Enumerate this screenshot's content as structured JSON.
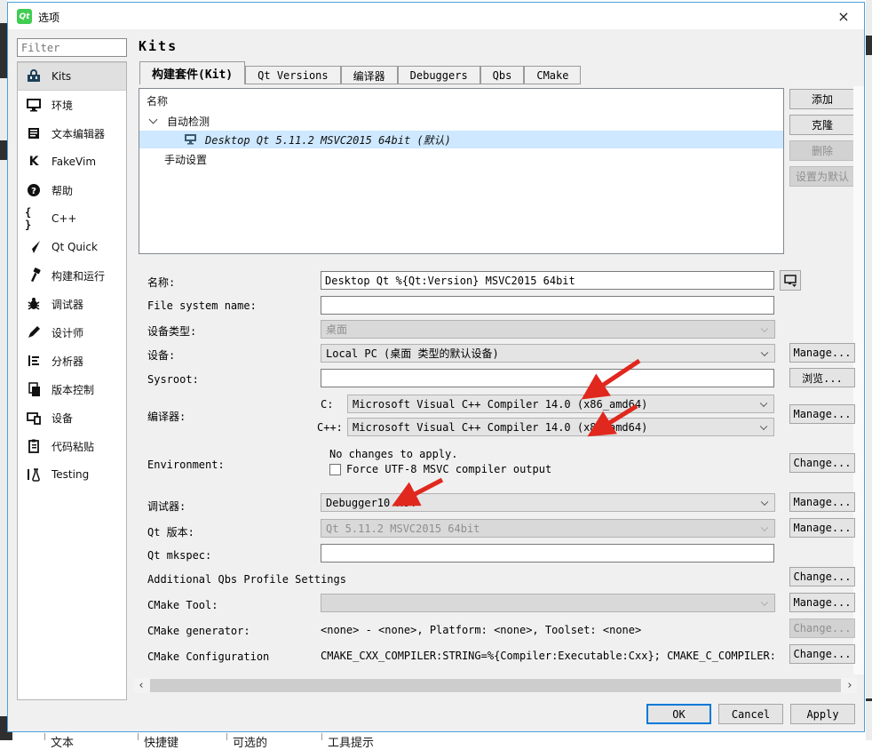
{
  "window": {
    "title": "选项",
    "close_glyph": "×"
  },
  "sidebar": {
    "filter_placeholder": "Filter",
    "items": [
      "Kits",
      "环境",
      "文本编辑器",
      "FakeVim",
      "帮助",
      "C++",
      "Qt Quick",
      "构建和运行",
      "调试器",
      "设计师",
      "分析器",
      "版本控制",
      "设备",
      "代码粘贴",
      "Testing"
    ]
  },
  "header": {
    "title": "Kits"
  },
  "tabs": [
    "构建套件(Kit)",
    "Qt Versions",
    "编译器",
    "Debuggers",
    "Qbs",
    "CMake"
  ],
  "tree": {
    "column_header": "名称",
    "auto_group": "自动检测",
    "kit_item": "Desktop Qt 5.11.2 MSVC2015 64bit (默认)",
    "manual_group": "手动设置"
  },
  "side_buttons": {
    "add": "添加",
    "clone": "克隆",
    "remove": "删除",
    "make_default": "设置为默认"
  },
  "form": {
    "name_label": "名称:",
    "name_value": "Desktop Qt %{Qt:Version} MSVC2015 64bit",
    "fs_label": "File system name:",
    "fs_value": "",
    "devtype_label": "设备类型:",
    "devtype_value": "桌面",
    "device_label": "设备:",
    "device_value": "Local PC (桌面 类型的默认设备)",
    "sysroot_label": "Sysroot:",
    "sysroot_value": "",
    "compiler_label": "编译器:",
    "c_label": "C:",
    "c_value": "Microsoft Visual C++ Compiler 14.0 (x86_amd64)",
    "cpp_label": "C++:",
    "cpp_value": "Microsoft Visual C++ Compiler 14.0 (x86_amd64)",
    "env_label": "Environment:",
    "env_status": "No changes to apply.",
    "env_checkbox_label": "Force UTF-8 MSVC compiler output",
    "debugger_label": "调试器:",
    "debugger_value": "Debugger10 x64",
    "qtver_label": "Qt 版本:",
    "qtver_value": "Qt 5.11.2 MSVC2015 64bit",
    "mkspec_label": "Qt mkspec:",
    "mkspec_value": "",
    "qbs_label": "Additional Qbs Profile Settings",
    "cmaketool_label": "CMake Tool:",
    "cmaketool_value": "",
    "cmakegen_label": "CMake generator:",
    "cmakegen_value": "<none> - <none>, Platform: <none>, Toolset: <none>",
    "cmakecfg_label": "CMake Configuration",
    "cmakecfg_value": "CMAKE_CXX_COMPILER:STRING=%{Compiler:Executable:Cxx}; CMAKE_C_COMPILER:STRING=%{Com…"
  },
  "buttons": {
    "manage": "Manage...",
    "browse": "浏览...",
    "change": "Change...",
    "ok": "OK",
    "cancel": "Cancel",
    "apply": "Apply"
  },
  "scrollbar": {
    "left_glyph": "‹",
    "right_glyph": "›"
  },
  "background_columns": {
    "col1": "文本",
    "col2": "快捷键",
    "col3": "可选的",
    "col4": "工具提示"
  },
  "colors": {
    "accent_blue": "#0078d7",
    "selection_blue": "#cde8ff",
    "annotation_red": "#e0281e",
    "qt_green": "#41cd52"
  }
}
